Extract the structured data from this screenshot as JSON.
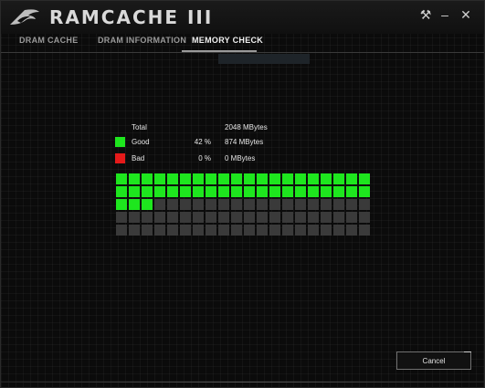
{
  "app": {
    "title": "RAMCACHE III",
    "logo_icon": "rog-eye-icon"
  },
  "window_controls": {
    "settings_icon": "wrench-icon",
    "settings_glyph": "⚒",
    "minimize_icon": "minimize-icon",
    "minimize_glyph": "–",
    "close_icon": "close-icon",
    "close_glyph": "✕"
  },
  "tabs": [
    {
      "label": "DRAM CACHE",
      "active": false
    },
    {
      "label": "DRAM INFORMATION",
      "active": false
    },
    {
      "label": "MEMORY CHECK",
      "active": true
    }
  ],
  "stats": {
    "total": {
      "label": "Total",
      "percent": "",
      "size": "2048 MBytes"
    },
    "good": {
      "label": "Good",
      "percent": "42 %",
      "size": "874 MBytes",
      "color": "#1ee61e"
    },
    "bad": {
      "label": "Bad",
      "percent": "0 %",
      "size": "0 MBytes",
      "color": "#e51a1a"
    }
  },
  "memory_grid": {
    "columns": 20,
    "rows": 5,
    "good_blocks": 43,
    "bad_blocks": 0,
    "colors": {
      "good": "#1ee61e",
      "bad": "#e51a1a",
      "pending": "#3a3a3a"
    }
  },
  "actions": {
    "cancel_label": "Cancel"
  }
}
